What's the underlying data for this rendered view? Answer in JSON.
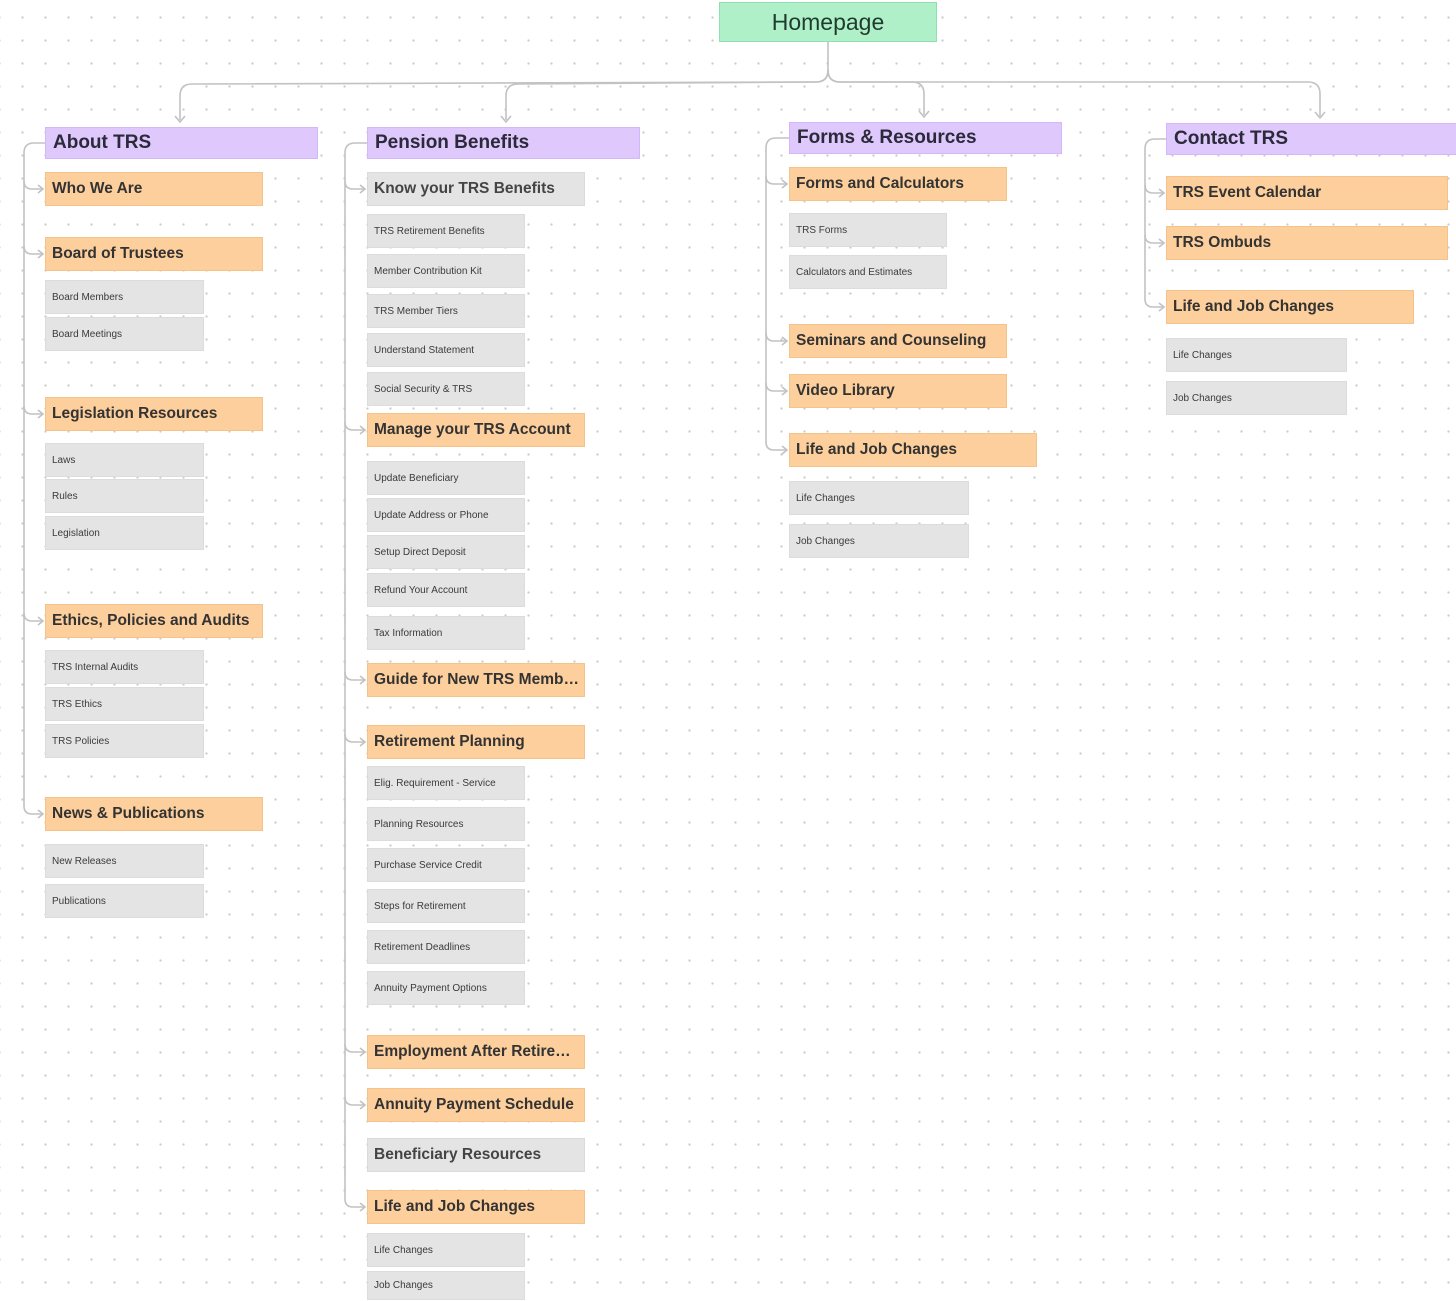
{
  "root": {
    "label": "Homepage"
  },
  "columns": [
    {
      "section": "About TRS",
      "pages": [
        {
          "label": "Who We Are",
          "children": []
        },
        {
          "label": "Board of Trustees",
          "children": [
            "Board Members",
            "Board Meetings"
          ]
        },
        {
          "label": "Legislation Resources",
          "children": [
            "Laws",
            "Rules",
            "Legislation"
          ]
        },
        {
          "label": "Ethics, Policies and Audits",
          "children": [
            "TRS Internal Audits",
            "TRS Ethics",
            "TRS Policies"
          ]
        },
        {
          "label": "News & Publications",
          "children": [
            "New Releases",
            "Publications"
          ]
        }
      ]
    },
    {
      "section": "Pension Benefits",
      "pages": [
        {
          "label": "Know your TRS Benefits",
          "children": [
            "TRS Retirement Benefits",
            "Member Contribution Kit",
            "TRS Member Tiers",
            "Understand Statement",
            "Social Security & TRS"
          ]
        },
        {
          "label": "Manage your TRS Account",
          "children": [
            "Update Beneficiary",
            "Update Address or Phone",
            "Setup Direct Deposit",
            "Refund Your Account",
            "Tax Information"
          ]
        },
        {
          "label": "Guide for New TRS Members",
          "children": []
        },
        {
          "label": "Retirement Planning",
          "children": [
            "Elig. Requirement - Service",
            "Planning Resources",
            "Purchase Service Credit",
            "Steps for Retirement",
            "Retirement Deadlines",
            "Annuity Payment Options"
          ]
        },
        {
          "label": "Employment After Retirement",
          "children": []
        },
        {
          "label": "Annuity Payment Schedule",
          "children": []
        },
        {
          "label": "Beneficiary Resources",
          "children": []
        },
        {
          "label": "Life and Job Changes",
          "children": [
            "Life Changes",
            "Job Changes"
          ]
        }
      ]
    },
    {
      "section": "Forms & Resources",
      "pages": [
        {
          "label": "Forms and Calculators",
          "children": [
            "TRS Forms",
            "Calculators and Estimates"
          ]
        },
        {
          "label": "Seminars and Counseling",
          "children": []
        },
        {
          "label": "Video Library",
          "children": []
        },
        {
          "label": "Life and Job Changes",
          "children": [
            "Life Changes",
            "Job Changes"
          ]
        }
      ]
    },
    {
      "section": "Contact TRS",
      "pages": [
        {
          "label": "TRS Event Calendar",
          "children": []
        },
        {
          "label": "TRS Ombuds",
          "children": []
        },
        {
          "label": "Life and Job Changes",
          "children": [
            "Life Changes",
            "Job Changes"
          ]
        }
      ]
    }
  ],
  "colors": {
    "root": "#b0f0c9",
    "section": "#dfc8fb",
    "page": "#fccf9c",
    "subpage": "#e4e4e4",
    "connector": "#c2c2c2"
  }
}
